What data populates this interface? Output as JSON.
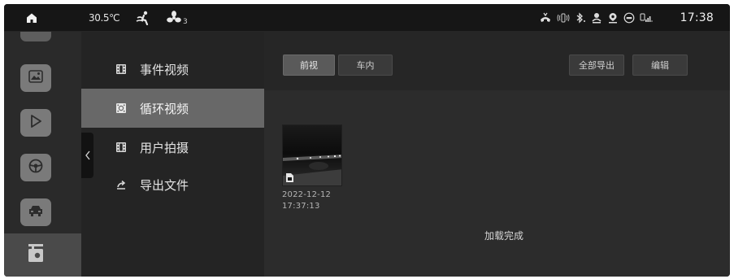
{
  "status_bar": {
    "temperature": "30.5℃",
    "fan_level": "3",
    "time": "17:38",
    "icons": [
      "home-icon",
      "air-direction-icon",
      "fan-icon",
      "phone-icon",
      "vibrate-icon",
      "bluetooth-icon",
      "driver-icon",
      "location-icon",
      "eco-icon",
      "signal-icon"
    ]
  },
  "dock": {
    "items": [
      {
        "name": "gallery",
        "icon": "image-icon"
      },
      {
        "name": "media",
        "icon": "play-icon"
      },
      {
        "name": "driving",
        "icon": "steering-wheel-icon"
      },
      {
        "name": "vehicle",
        "icon": "car-icon"
      },
      {
        "name": "dashcam",
        "icon": "dashcam-icon",
        "active": true
      }
    ]
  },
  "menu": {
    "items": [
      {
        "label": "事件视频",
        "icon": "film-icon"
      },
      {
        "label": "循环视频",
        "icon": "loop-film-icon",
        "active": true
      },
      {
        "label": "用户拍摄",
        "icon": "film-icon"
      },
      {
        "label": "导出文件",
        "icon": "share-icon"
      }
    ]
  },
  "toolbar": {
    "tabs": [
      {
        "label": "前视",
        "active": true
      },
      {
        "label": "车内",
        "active": false
      }
    ],
    "export_all_label": "全部导出",
    "edit_label": "编辑"
  },
  "videos": [
    {
      "date": "2022-12-12",
      "time": "17:37:13"
    }
  ],
  "status_message": "加载完成",
  "colors": {
    "background": "#1c1c1c",
    "active_menu": "#686868",
    "button": "#3a3a3a"
  }
}
